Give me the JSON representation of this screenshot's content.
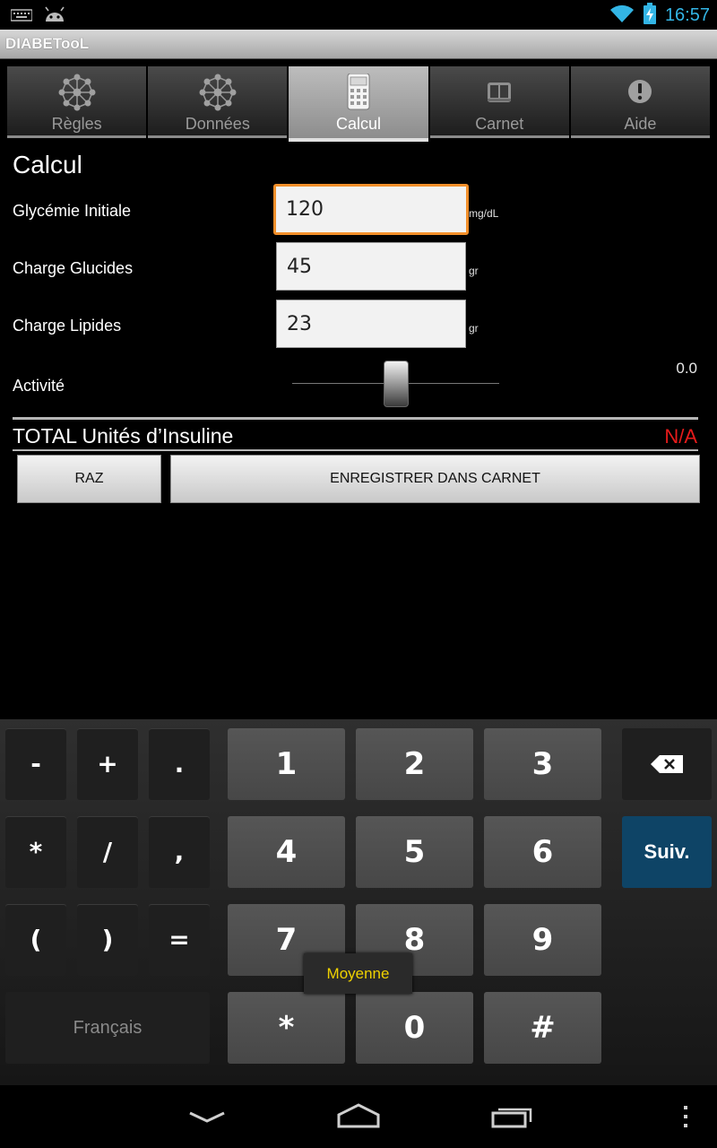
{
  "status_bar": {
    "time": "16:57",
    "colors": {
      "clock": "#33b5e5"
    }
  },
  "app": {
    "title": "DIABETooL"
  },
  "tabs": [
    {
      "label": "Règles",
      "icon": "molecule-icon",
      "active": false
    },
    {
      "label": "Données",
      "icon": "molecule-icon",
      "active": false
    },
    {
      "label": "Calcul",
      "icon": "calculator-icon",
      "active": true
    },
    {
      "label": "Carnet",
      "icon": "book-icon",
      "active": false
    },
    {
      "label": "Aide",
      "icon": "alert-icon",
      "active": false
    }
  ],
  "calcul": {
    "title": "Calcul",
    "fields": {
      "glycemie": {
        "label": "Glycémie Initiale",
        "value": "120",
        "unit": "mg/dL"
      },
      "glucides": {
        "label": "Charge Glucides",
        "value": "45",
        "unit": "gr"
      },
      "lipides": {
        "label": "Charge Lipides",
        "value": "23",
        "unit": "gr"
      }
    },
    "activity": {
      "label": "Activité",
      "value": "0.0",
      "slider_fraction": 0.5
    },
    "total": {
      "label": "TOTAL Unités d’Insuline",
      "value": "N/A",
      "value_color": "#e61b1b"
    },
    "buttons": {
      "reset": "RAZ",
      "save": "ENREGISTRER DANS CARNET"
    }
  },
  "keyboard": {
    "symbols": [
      "-",
      "+",
      ".",
      "*",
      "/",
      ",",
      "(",
      ")",
      "="
    ],
    "numbers": [
      "1",
      "2",
      "3",
      "4",
      "5",
      "6",
      "7",
      "8",
      "9",
      "*",
      "0",
      "#"
    ],
    "language": "Français",
    "next": "Suiv.",
    "tooltip": "Moyenne",
    "next_color": "#0e4466"
  }
}
